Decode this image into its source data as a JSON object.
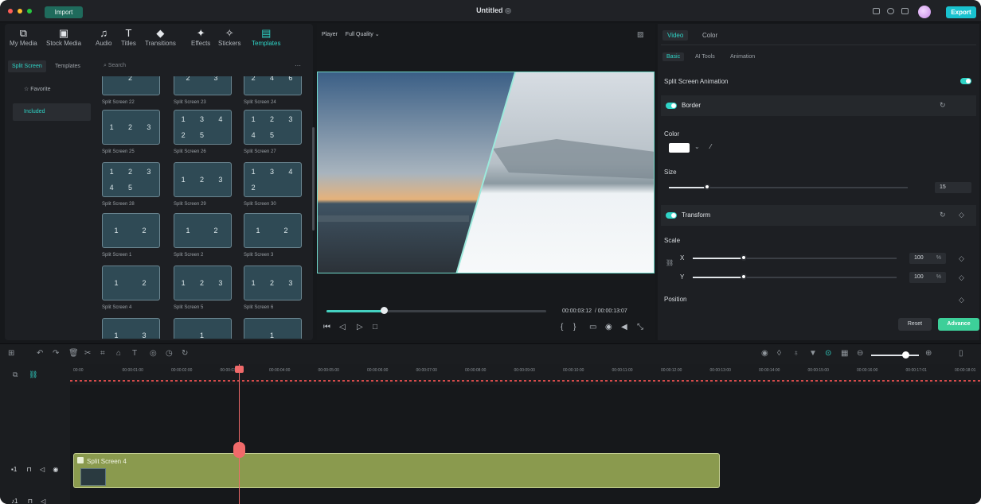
{
  "window": {
    "title": "Untitled",
    "import_label": "Import",
    "export_label": "Export"
  },
  "library": {
    "categories": [
      {
        "icon": "my-media-icon",
        "glyph": "⧉",
        "label": "My Media"
      },
      {
        "icon": "stock-media-icon",
        "glyph": "▣",
        "label": "Stock Media"
      },
      {
        "icon": "audio-icon",
        "glyph": "♫",
        "label": "Audio"
      },
      {
        "icon": "titles-icon",
        "glyph": "T",
        "label": "Titles"
      },
      {
        "icon": "transitions-icon",
        "glyph": "◆",
        "label": "Transitions"
      },
      {
        "icon": "effects-icon",
        "glyph": "✦",
        "label": "Effects"
      },
      {
        "icon": "stickers-icon",
        "glyph": "✧",
        "label": "Stickers"
      },
      {
        "icon": "templates-icon",
        "glyph": "▤",
        "label": "Templates"
      }
    ],
    "subtabs": [
      "Split Screen",
      "Templates"
    ],
    "search_placeholder": "Search",
    "side_items": [
      "Favorite",
      "Included"
    ],
    "thumbs": [
      {
        "label": "Split Screen 22",
        "nums": [
          "2"
        ]
      },
      {
        "label": "Split Screen 23",
        "nums": [
          "2",
          "3"
        ]
      },
      {
        "label": "Split Screen 24",
        "nums": [
          "2",
          "4",
          "6"
        ]
      },
      {
        "label": "Split Screen 25",
        "nums": [
          "1",
          "2",
          "3"
        ]
      },
      {
        "label": "Split Screen 26",
        "nums": [
          "1",
          "3",
          "4",
          "2",
          "5"
        ]
      },
      {
        "label": "Split Screen 27",
        "nums": [
          "1",
          "2",
          "3",
          "4",
          "5"
        ]
      },
      {
        "label": "Split Screen 28",
        "nums": [
          "1",
          "2",
          "3",
          "4",
          "5"
        ]
      },
      {
        "label": "Split Screen 29",
        "nums": [
          "1",
          "2",
          "3"
        ]
      },
      {
        "label": "Split Screen 30",
        "nums": [
          "1",
          "3",
          "4",
          "2"
        ]
      },
      {
        "label": "Split Screen 1",
        "nums": [
          "1",
          "2"
        ]
      },
      {
        "label": "Split Screen 2",
        "nums": [
          "1",
          "2"
        ]
      },
      {
        "label": "Split Screen 3",
        "nums": [
          "1",
          "2"
        ]
      },
      {
        "label": "Split Screen 4",
        "nums": [
          "1",
          "2"
        ]
      },
      {
        "label": "Split Screen 5",
        "nums": [
          "1",
          "2",
          "3"
        ]
      },
      {
        "label": "Split Screen 6",
        "nums": [
          "1",
          "2",
          "3"
        ]
      },
      {
        "label": "",
        "nums": [
          "1",
          "3"
        ]
      },
      {
        "label": "",
        "nums": [
          "1"
        ]
      },
      {
        "label": "",
        "nums": [
          "1"
        ]
      }
    ]
  },
  "player": {
    "label": "Player",
    "quality": "Full Quality",
    "current": "00:00:03:12",
    "total": "/ 00:00:13:07",
    "progress": 0.26
  },
  "inspector": {
    "tabs": [
      "Video",
      "Color"
    ],
    "subtabs": [
      "Basic",
      "AI Tools",
      "Animation"
    ],
    "split_anim": "Split Screen Animation",
    "border": "Border",
    "color_label": "Color",
    "size_label": "Size",
    "size_value": "15",
    "transform": "Transform",
    "scale_label": "Scale",
    "x_label": "X",
    "y_label": "Y",
    "x_value": "100",
    "y_value": "100",
    "pct": "%",
    "position_label": "Position",
    "reset": "Reset",
    "advance": "Advance"
  },
  "timeline": {
    "ticks": [
      "00:00",
      "00:00:01:00",
      "00:00:02:00",
      "00:00:03:00",
      "00:00:04:00",
      "00:00:05:00",
      "00:00:06:00",
      "00:00:07:00",
      "00:00:08:00",
      "00:00:09:00",
      "00:00:10:00",
      "00:00:11:00",
      "00:00:12:00",
      "00:00:13:00",
      "00:00:14:00",
      "00:00:15:00",
      "00:00:16:00",
      "00:00:17:01",
      "00:00:18:01"
    ],
    "clip_label": "Split Screen 4",
    "track1": "1",
    "track2": "1"
  },
  "colors": {
    "accent": "#2fd3c6",
    "clip": "#8a9a4e",
    "playhead": "#f06a6a",
    "export": "#19c2cf"
  }
}
